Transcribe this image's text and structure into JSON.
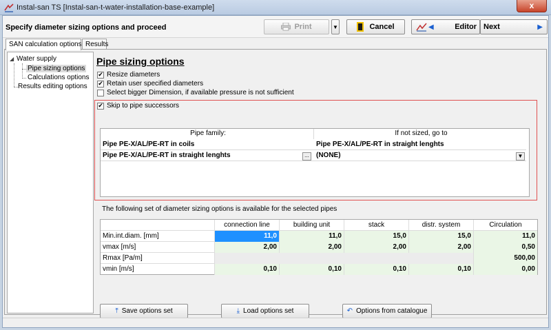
{
  "window": {
    "title": "Instal-san TS [Instal-san-t-water-installation-base-example]",
    "close_glyph": "x"
  },
  "toolbar": {
    "heading": "Specify diameter sizing options and proceed",
    "print_label": "Print",
    "cancel_label": "Cancel",
    "editor_label": "Editor",
    "next_label": "Next"
  },
  "tabs": [
    {
      "label": "SAN calculation options",
      "active": true
    },
    {
      "label": "Results",
      "active": false
    }
  ],
  "tree": {
    "items": [
      {
        "label": "Water supply",
        "selected": false
      },
      {
        "label": "Pipe sizing options",
        "selected": true
      },
      {
        "label": "Calculations options",
        "selected": false
      },
      {
        "label": "Results editing options",
        "selected": false
      }
    ]
  },
  "pipe_sizing": {
    "title": "Pipe sizing options",
    "options": [
      {
        "label": "Resize diameters",
        "checked": true
      },
      {
        "label": "Retain user specified diameters",
        "checked": true
      },
      {
        "label": "Select bigger Dimension, if available pressure is not sufficient",
        "checked": false
      }
    ],
    "skip_label": "Skip to pipe successors",
    "skip_checked": true,
    "grid": {
      "headers": [
        "Pipe family:",
        "If not sized, go to"
      ],
      "rows": [
        {
          "family": "Pipe PE-X/AL/PE-RT in coils",
          "goto": "Pipe PE-X/AL/PE-RT in straight lenghts"
        },
        {
          "family": "Pipe PE-X/AL/PE-RT in straight lenghts",
          "goto": "(NONE)"
        }
      ],
      "ellipsis": "..."
    }
  },
  "options_info": "The following set of diameter sizing options is available for the selected pipes",
  "options_table": {
    "columns": [
      "connection line",
      "building unit",
      "stack",
      "distr. system",
      "Circulation"
    ],
    "rows": [
      {
        "label": "Min.int.diam. [mm]",
        "values": [
          "11,0",
          "11,0",
          "15,0",
          "15,0",
          "11,0"
        ]
      },
      {
        "label": "vmax [m/s]",
        "values": [
          "2,00",
          "2,00",
          "2,00",
          "2,00",
          "0,50"
        ]
      },
      {
        "label": "Rmax [Pa/m]",
        "values": [
          "",
          "",
          "",
          "",
          "500,00"
        ]
      },
      {
        "label": "vmin [m/s]",
        "values": [
          "0,10",
          "0,10",
          "0,10",
          "0,10",
          "0,00"
        ]
      }
    ]
  },
  "buttons": {
    "save": "Save options set",
    "load": "Load options set",
    "catalogue": "Options from catalogue"
  },
  "colors": {
    "selected_cell": "#1e90ff",
    "editable_cell": "#eaf6e6",
    "disabled_cell": "#ececec",
    "frame_highlight": "#e05050"
  }
}
